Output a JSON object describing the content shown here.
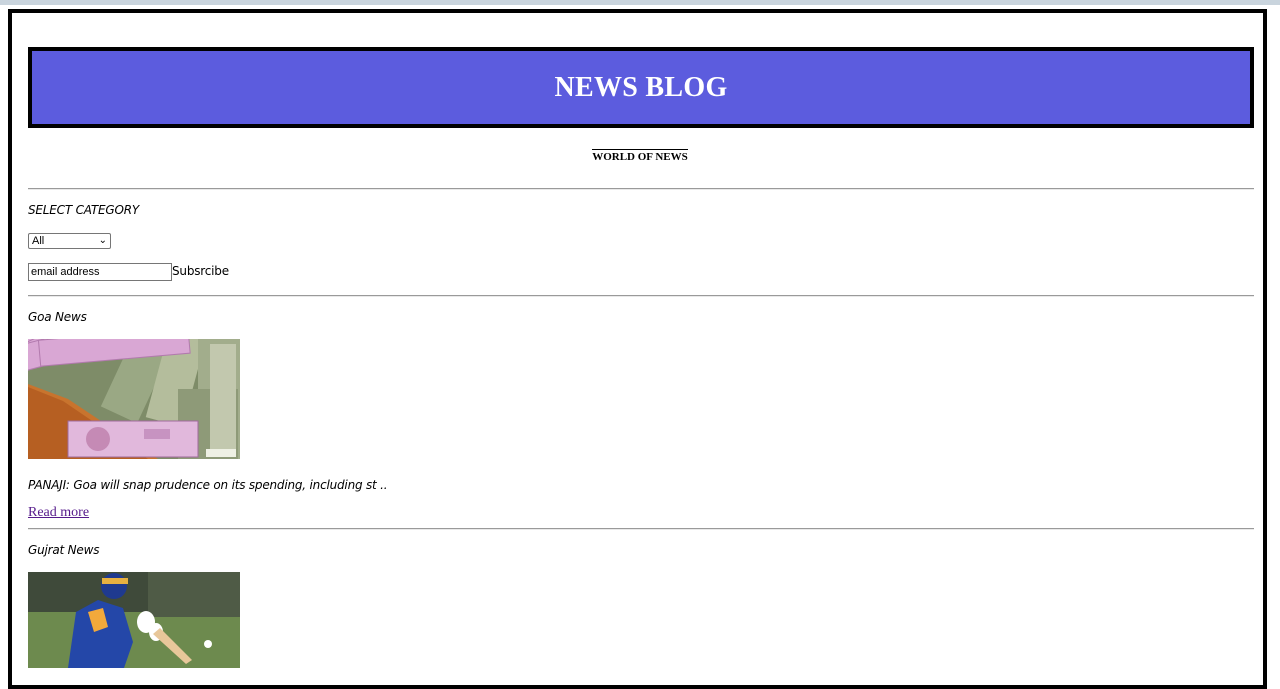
{
  "header": {
    "title": "NEWS BLOG",
    "subtitle": "WORLD OF NEWS"
  },
  "controls": {
    "category_label": "SELECT CATEGORY",
    "category_selected": "All",
    "email_value": "email address",
    "subscribe_label": "Subsrcibe"
  },
  "posts": [
    {
      "category": "Goa News",
      "image": "indian-currency-notes-image",
      "excerpt": "PANAJI: Goa will snap prudence on its spending, including st ..",
      "read_more": "Read more"
    },
    {
      "category": "Gujrat News",
      "image": "cricketer-batting-image"
    }
  ],
  "colors": {
    "header_bg": "#5c5cde",
    "link_visited": "#551a8b"
  }
}
